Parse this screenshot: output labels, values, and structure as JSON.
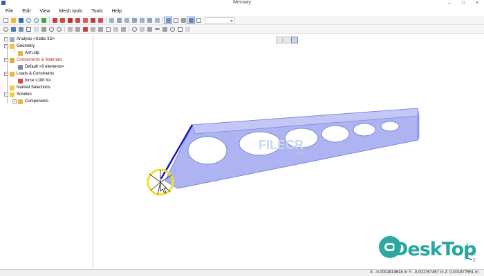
{
  "window": {
    "title": "Mecway"
  },
  "menu": [
    "File",
    "Edit",
    "View",
    "Mesh tools",
    "Tools",
    "Help"
  ],
  "tree": {
    "root": "Analysis <Static 3D>",
    "geometry": "Geometry",
    "geometry_child": "Arm.stp",
    "components": "Components & Materials",
    "components_child": "Default <9 elements>",
    "loads": "Loads & Constraints",
    "loads_child": "force <100 N>",
    "named": "Named Selections",
    "solution": "Solution",
    "solution_child": "Components"
  },
  "watermark": {
    "text": "DeskTop",
    "logo_text": "FILECR",
    "logo_sub": ".com"
  },
  "axes": {
    "x": "X",
    "y": "Y",
    "z": "Z"
  },
  "status": {
    "coords": "X: -0.0002819618 m Y: -0.001767457 m Z: 0.001877551 m"
  },
  "colors": {
    "beam": "#aeb4f2",
    "beam_edge": "#7e86d8",
    "constraint": "#1515c8",
    "highlight": "#f1e02a",
    "tree_red": "#c0241f"
  }
}
